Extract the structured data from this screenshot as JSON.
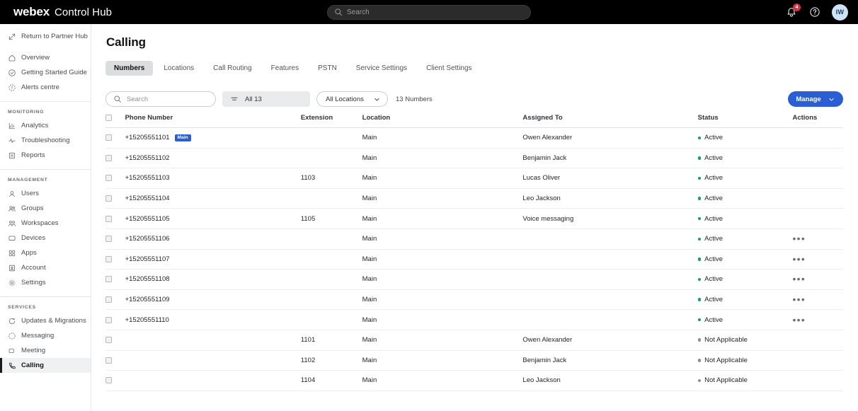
{
  "topbar": {
    "brand_primary": "webex",
    "brand_secondary": "Control Hub",
    "search_placeholder": "Search",
    "search_icon": "search-icon",
    "notifications_icon": "bell-icon",
    "notifications_count": "4",
    "help_icon": "help-circle-icon",
    "avatar_initials": "IW"
  },
  "sidebar": {
    "return_link": {
      "label": "Return to Partner Hub",
      "icon": "external-link-icon"
    },
    "primary": [
      {
        "label": "Overview",
        "icon": "home-icon"
      },
      {
        "label": "Getting Started Guide",
        "icon": "check-circle-icon"
      },
      {
        "label": "Alerts centre",
        "icon": "alert-icon"
      }
    ],
    "sections": [
      {
        "heading": "MONITORING",
        "items": [
          {
            "label": "Analytics",
            "icon": "chart-bar-icon"
          },
          {
            "label": "Troubleshooting",
            "icon": "pulse-icon"
          },
          {
            "label": "Reports",
            "icon": "report-icon"
          }
        ]
      },
      {
        "heading": "MANAGEMENT",
        "items": [
          {
            "label": "Users",
            "icon": "user-icon"
          },
          {
            "label": "Groups",
            "icon": "users-icon"
          },
          {
            "label": "Workspaces",
            "icon": "workspace-icon"
          },
          {
            "label": "Devices",
            "icon": "device-icon"
          },
          {
            "label": "Apps",
            "icon": "apps-icon"
          },
          {
            "label": "Account",
            "icon": "account-icon"
          },
          {
            "label": "Settings",
            "icon": "gear-icon"
          }
        ]
      },
      {
        "heading": "SERVICES",
        "items": [
          {
            "label": "Updates & Migrations",
            "icon": "refresh-icon"
          },
          {
            "label": "Messaging",
            "icon": "message-icon"
          },
          {
            "label": "Meeting",
            "icon": "meeting-icon"
          },
          {
            "label": "Calling",
            "icon": "phone-icon",
            "selected": true
          }
        ]
      }
    ]
  },
  "main": {
    "page_title": "Calling",
    "tabs": [
      {
        "label": "Numbers",
        "active": true
      },
      {
        "label": "Locations",
        "active": false
      },
      {
        "label": "Call Routing",
        "active": false
      },
      {
        "label": "Features",
        "active": false
      },
      {
        "label": "PSTN",
        "active": false
      },
      {
        "label": "Service Settings",
        "active": false
      },
      {
        "label": "Client Settings",
        "active": false
      }
    ],
    "toolbar": {
      "search_placeholder": "Search",
      "search_icon": "search-icon",
      "filter_label": "All 13",
      "filter_icon": "filter-lines-icon",
      "location_select": "All Locations",
      "location_chevron": "chevron-down-icon",
      "count_label": "13 Numbers",
      "manage_label": "Manage",
      "manage_chevron": "chevron-down-icon",
      "manage_color": "#2a5fd4"
    },
    "table": {
      "columns": [
        "Phone Number",
        "Extension",
        "Location",
        "Assigned To",
        "Status",
        "Actions"
      ],
      "main_tag": "Main",
      "actions_glyph": "•••",
      "status_colors": {
        "active": "#1a9a6a",
        "not_applicable": "#8c9096"
      },
      "rows": [
        {
          "phone": "+15205551101",
          "tag": "Main",
          "extension": "",
          "location": "Main",
          "assigned": "Owen Alexander",
          "status": "Active",
          "status_kind": "active",
          "actions": false
        },
        {
          "phone": "+15205551102",
          "tag": "",
          "extension": "",
          "location": "Main",
          "assigned": "Benjamin Jack",
          "status": "Active",
          "status_kind": "active",
          "actions": false
        },
        {
          "phone": "+15205551103",
          "tag": "",
          "extension": "1103",
          "location": "Main",
          "assigned": "Lucas Oliver",
          "status": "Active",
          "status_kind": "active",
          "actions": false
        },
        {
          "phone": "+15205551104",
          "tag": "",
          "extension": "",
          "location": "Main",
          "assigned": "Leo Jackson",
          "status": "Active",
          "status_kind": "active",
          "actions": false
        },
        {
          "phone": "+15205551105",
          "tag": "",
          "extension": "1105",
          "location": "Main",
          "assigned": "Voice messaging",
          "status": "Active",
          "status_kind": "active",
          "actions": false
        },
        {
          "phone": "+15205551106",
          "tag": "",
          "extension": "",
          "location": "Main",
          "assigned": "",
          "status": "Active",
          "status_kind": "active",
          "actions": true
        },
        {
          "phone": "+15205551107",
          "tag": "",
          "extension": "",
          "location": "Main",
          "assigned": "",
          "status": "Active",
          "status_kind": "active",
          "actions": true
        },
        {
          "phone": "+15205551108",
          "tag": "",
          "extension": "",
          "location": "Main",
          "assigned": "",
          "status": "Active",
          "status_kind": "active",
          "actions": true
        },
        {
          "phone": "+15205551109",
          "tag": "",
          "extension": "",
          "location": "Main",
          "assigned": "",
          "status": "Active",
          "status_kind": "active",
          "actions": true
        },
        {
          "phone": "+15205551110",
          "tag": "",
          "extension": "",
          "location": "Main",
          "assigned": "",
          "status": "Active",
          "status_kind": "active",
          "actions": true
        },
        {
          "phone": "",
          "tag": "",
          "extension": "1101",
          "location": "Main",
          "assigned": "Owen Alexander",
          "status": "Not Applicable",
          "status_kind": "na",
          "actions": false
        },
        {
          "phone": "",
          "tag": "",
          "extension": "1102",
          "location": "Main",
          "assigned": "Benjamin Jack",
          "status": "Not Applicable",
          "status_kind": "na",
          "actions": false
        },
        {
          "phone": "",
          "tag": "",
          "extension": "1104",
          "location": "Main",
          "assigned": "Leo Jackson",
          "status": "Not Applicable",
          "status_kind": "na",
          "actions": false
        }
      ]
    }
  }
}
